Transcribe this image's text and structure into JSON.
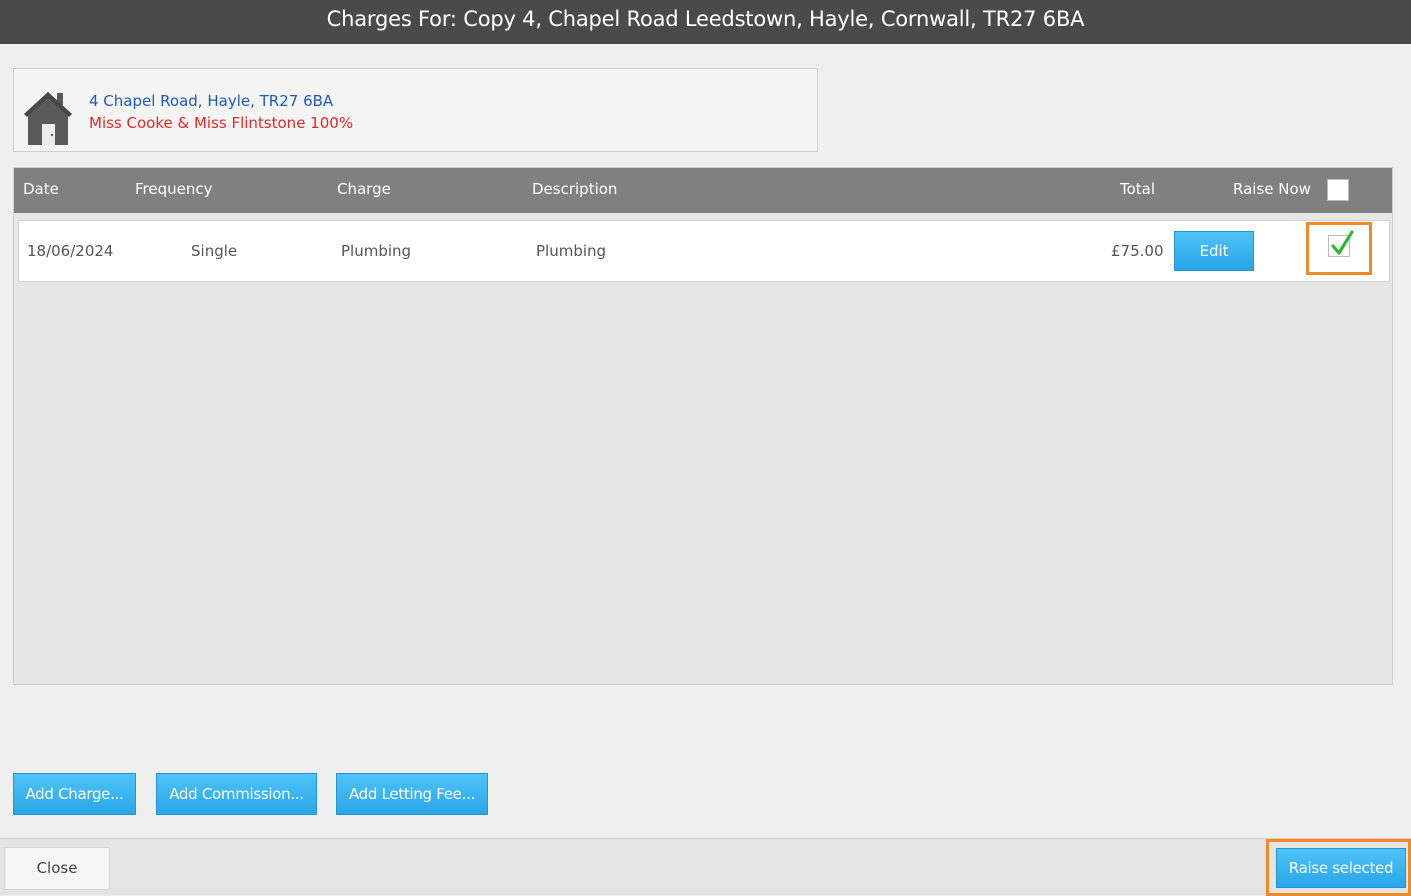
{
  "window": {
    "title": "Charges For: Copy 4, Chapel Road Leedstown, Hayle, Cornwall, TR27 6BA"
  },
  "property": {
    "address": "4 Chapel Road, Hayle, TR27 6BA",
    "owners": "Miss Cooke & Miss Flintstone 100%",
    "icon": "house-icon"
  },
  "table": {
    "headers": {
      "date": "Date",
      "frequency": "Frequency",
      "charge": "Charge",
      "description": "Description",
      "total": "Total",
      "raise_now": "Raise Now"
    },
    "header_checked": false,
    "rows": [
      {
        "date": "18/06/2024",
        "frequency": "Single",
        "charge": "Plumbing",
        "description": "Plumbing",
        "total": "£75.00",
        "edit_label": "Edit",
        "raise_now": true
      }
    ]
  },
  "actions": {
    "add_charge": "Add Charge...",
    "add_commission": "Add Commission...",
    "add_letting_fee": "Add Letting Fee..."
  },
  "footer": {
    "close": "Close",
    "raise_selected": "Raise selected"
  },
  "colors": {
    "titlebar": "#4a4a4a",
    "accent_blue": "#29a6e8",
    "highlight_orange": "#f08a24",
    "address_blue": "#1f57c3",
    "owner_red": "#e02a2a",
    "check_green": "#2eb82e"
  }
}
